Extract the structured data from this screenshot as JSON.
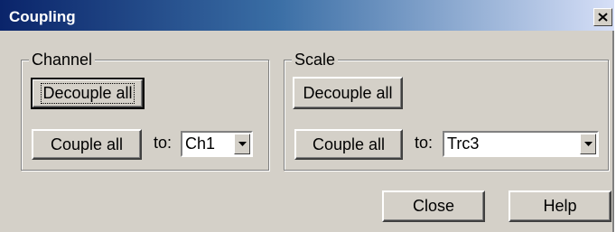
{
  "window": {
    "title": "Coupling",
    "close_icon": "close-icon"
  },
  "channel_group": {
    "legend": "Channel",
    "decouple_label": "Decouple all",
    "couple_label": "Couple all",
    "to_label": "to:",
    "selected": "Ch1"
  },
  "scale_group": {
    "legend": "Scale",
    "decouple_label": "Decouple all",
    "couple_label": "Couple all",
    "to_label": "to:",
    "selected": "Trc3"
  },
  "footer": {
    "close_label": "Close",
    "help_label": "Help"
  }
}
